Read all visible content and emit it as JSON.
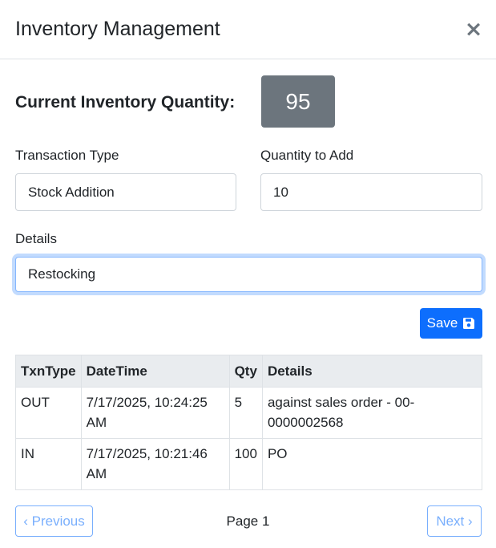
{
  "header": {
    "title": "Inventory Management",
    "close_glyph": "×"
  },
  "inventory": {
    "current_label": "Current Inventory Quantity:",
    "current_quantity": "95"
  },
  "form": {
    "transaction_type_label": "Transaction Type",
    "transaction_type_value": "Stock Addition",
    "quantity_label": "Quantity to Add",
    "quantity_value": "10",
    "details_label": "Details",
    "details_value": "Restocking"
  },
  "save_button": {
    "label": "Save",
    "icon": "floppy-disk-icon"
  },
  "table": {
    "columns": [
      "TxnType",
      "DateTime",
      "Qty",
      "Details"
    ],
    "rows": [
      {
        "type": "OUT",
        "datetime": "7/17/2025, 10:24:25 AM",
        "qty": "5",
        "details": "against sales order - 00-0000002568"
      },
      {
        "type": "IN",
        "datetime": "7/17/2025, 10:21:46 AM",
        "qty": "100",
        "details": "PO"
      }
    ]
  },
  "pagination": {
    "previous_label": "‹ Previous",
    "page_label": "Page 1",
    "next_label": "Next ›"
  },
  "colors": {
    "primary": "#0d6efd",
    "badge": "#6c757d",
    "table_header_bg": "#e9ecef",
    "focus_ring": "#86b7fe"
  }
}
